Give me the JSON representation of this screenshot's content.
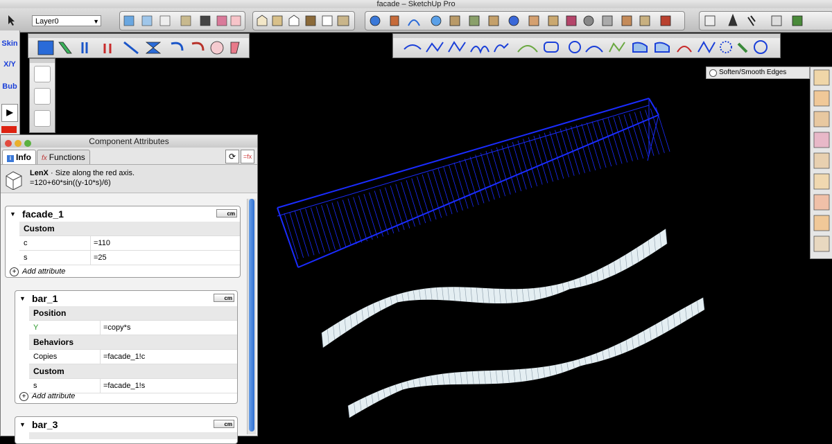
{
  "window": {
    "title": "facade – SketchUp Pro"
  },
  "toolbar": {
    "layer_select": "Layer0"
  },
  "soften": {
    "label": "Soften/Smooth Edges"
  },
  "left_tools": {
    "skin": "Skin",
    "xy": "X/Y",
    "bub": "Bub"
  },
  "panel": {
    "title": "Component Attributes",
    "tabs": [
      {
        "label": "Info"
      },
      {
        "label": "Functions"
      }
    ],
    "info": {
      "name": "LenX",
      "desc": "· Size along the red axis.",
      "formula": "=120+60*sin((y-10*s)/6)"
    },
    "unit": "cm",
    "cards": [
      {
        "name": "facade_1",
        "sections": [
          {
            "label": "Custom",
            "rows": [
              {
                "k": "c",
                "v": "=110"
              },
              {
                "k": "s",
                "v": "=25"
              }
            ]
          }
        ],
        "add": "Add attribute"
      },
      {
        "name": "bar_1",
        "sections": [
          {
            "label": "Position",
            "rows": [
              {
                "k": "Y",
                "v": "=copy*s"
              }
            ]
          },
          {
            "label": "Behaviors",
            "rows": [
              {
                "k": "Copies",
                "v": "=facade_1!c"
              }
            ]
          },
          {
            "label": "Custom",
            "rows": [
              {
                "k": "s",
                "v": "=facade_1!s"
              }
            ]
          }
        ],
        "add": "Add attribute"
      },
      {
        "name": "bar_3"
      }
    ]
  },
  "colors": {
    "wire": "#1a2cff",
    "surface": "#e4eef2",
    "background": "#000000"
  }
}
